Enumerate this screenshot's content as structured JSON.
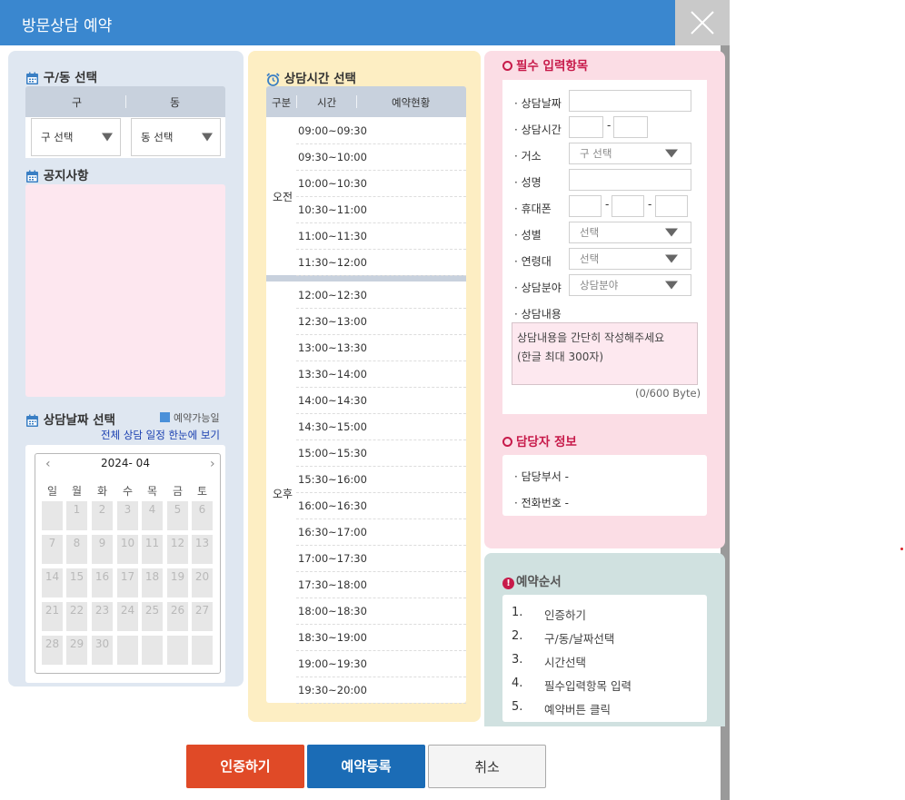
{
  "window": {
    "title": "방문상담 예약"
  },
  "left": {
    "gudong_title": "구/동 선택",
    "gu_label": "구",
    "dong_label": "동",
    "gu_select": "구 선택",
    "dong_select": "동 선택",
    "notice_title": "공지사항",
    "date_title": "상담날짜 선택",
    "legend": "예약가능일",
    "all_link": "전체 상담 일정 한눈에 보기",
    "calendar": {
      "month": "2024- 04",
      "prev": "‹",
      "next": "›",
      "weekdays": [
        "일",
        "월",
        "화",
        "수",
        "목",
        "금",
        "토"
      ],
      "days": [
        "",
        "1",
        "2",
        "3",
        "4",
        "5",
        "6",
        "7",
        "8",
        "9",
        "10",
        "11",
        "12",
        "13",
        "14",
        "15",
        "16",
        "17",
        "18",
        "19",
        "20",
        "21",
        "22",
        "23",
        "24",
        "25",
        "26",
        "27",
        "28",
        "29",
        "30",
        "",
        "",
        "",
        ""
      ]
    }
  },
  "middle": {
    "title": "상담시간 선택",
    "col_type": "구분",
    "col_time": "시간",
    "col_status": "예약현황",
    "am_label": "오전",
    "pm_label": "오후",
    "am_slots": [
      "09:00~09:30",
      "09:30~10:00",
      "10:00~10:30",
      "10:30~11:00",
      "11:00~11:30",
      "11:30~12:00"
    ],
    "pm_slots": [
      "12:00~12:30",
      "12:30~13:00",
      "13:00~13:30",
      "13:30~14:00",
      "14:00~14:30",
      "14:30~15:00",
      "15:00~15:30",
      "15:30~16:00",
      "16:00~16:30",
      "16:30~17:00",
      "17:00~17:30",
      "17:30~18:00",
      "18:00~18:30",
      "18:30~19:00",
      "19:00~19:30",
      "19:30~20:00"
    ]
  },
  "form": {
    "title": "필수 입력항목",
    "date_label": "· 상담날짜",
    "time_label": "· 상담시간",
    "residence_label": "· 거소",
    "residence_select": "구 선택",
    "name_label": "· 성명",
    "phone_label": "· 휴대폰",
    "gender_label": "· 성별",
    "gender_select": "선택",
    "age_label": "· 연령대",
    "age_select": "선택",
    "field_label": "· 상담분야",
    "field_select": "상담분야",
    "content_label": "· 상담내용",
    "content_placeholder": "상담내용을 간단히 작성해주세요\n(한글 최대 300자)",
    "counter": "(0/600 Byte)",
    "dash": "-"
  },
  "manager": {
    "title": "담당자 정보",
    "dept_label": "· 담당부서  -",
    "tel_label": "· 전화번호  -"
  },
  "steps": {
    "title": "예약순서",
    "items": [
      {
        "num": "1.",
        "text": "인증하기"
      },
      {
        "num": "2.",
        "text": "구/동/날짜선택"
      },
      {
        "num": "3.",
        "text": "시간선택"
      },
      {
        "num": "4.",
        "text": "필수입력항목 입력"
      },
      {
        "num": "5.",
        "text": "예약버튼 클릭"
      }
    ]
  },
  "buttons": {
    "verify": "인증하기",
    "register": "예약등록",
    "cancel": "취소"
  },
  "colors": {
    "titlebar": "#3a87cf",
    "verify": "#e04a27",
    "register": "#1b6cb6",
    "accent_red": "#c71a4a"
  }
}
